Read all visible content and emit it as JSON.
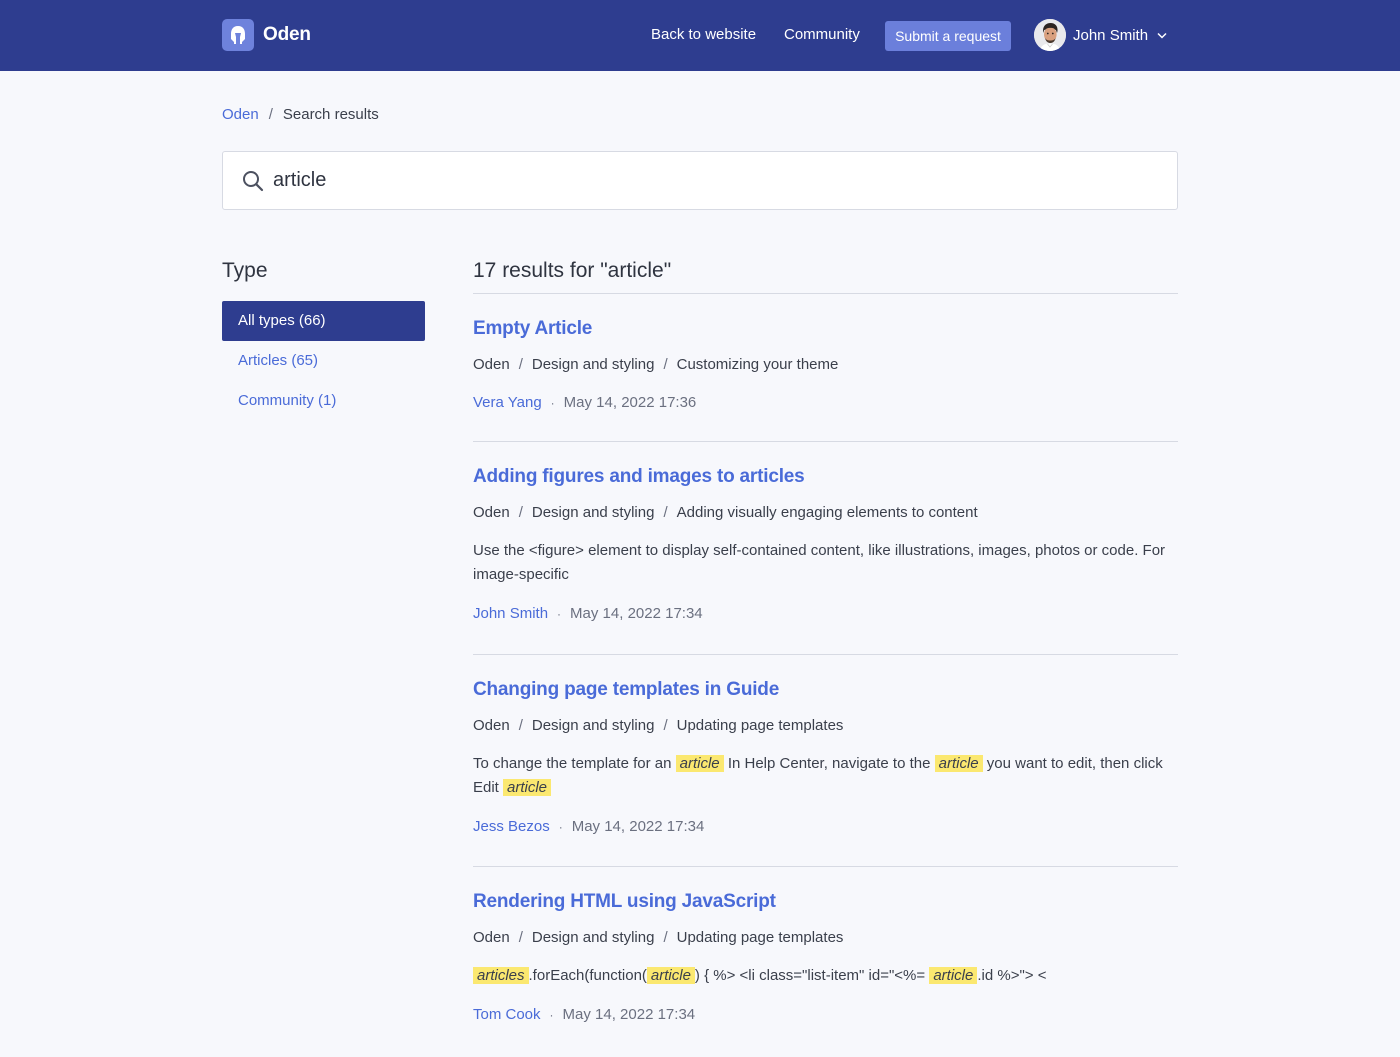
{
  "header": {
    "brand_name": "Oden",
    "nav": {
      "back_label": "Back to website",
      "community_label": "Community",
      "submit_label": "Submit a request"
    },
    "user": {
      "name": "John Smith"
    },
    "background_color": "#2e3d8f",
    "accent_color": "#6b7fdb"
  },
  "breadcrumb": {
    "home": "Oden",
    "separator": "/",
    "current": "Search results"
  },
  "search": {
    "value": "article",
    "icon": "search-icon"
  },
  "sidebar": {
    "title": "Type",
    "filters": [
      {
        "label": "All types (66)",
        "active": true
      },
      {
        "label": "Articles (65)",
        "active": false
      },
      {
        "label": "Community (1)",
        "active": false
      }
    ]
  },
  "results": {
    "count_text": "17 results for \"article\"",
    "separator": "/",
    "items": [
      {
        "title": "Empty Article",
        "path": [
          "Oden",
          "Design and styling",
          "Customizing your theme"
        ],
        "author": "Vera Yang",
        "date": "May 14, 2022 17:36"
      },
      {
        "title": "Adding figures and images to articles",
        "path": [
          "Oden",
          "Design and styling",
          "Adding visually engaging elements to content"
        ],
        "snippet": "Use the <figure> element to display self-contained content, like illustrations, images, photos or code. For image-specific",
        "author": "John Smith",
        "date": "May 14, 2022 17:34"
      },
      {
        "title": "Changing page templates in Guide",
        "path": [
          "Oden",
          "Design and styling",
          "Updating page templates"
        ],
        "snippet_parts": [
          "To change the template for an ",
          "article",
          " In Help Center, navigate to the ",
          "article",
          " you want to edit, then click Edit ",
          "article"
        ],
        "author": "Jess Bezos",
        "date": "May 14, 2022 17:34"
      },
      {
        "title": "Rendering HTML using JavaScript",
        "path": [
          "Oden",
          "Design and styling",
          "Updating page templates"
        ],
        "snippet_parts": [
          "articles",
          ".forEach(function(",
          "article",
          ") { %> <li class=\"list-item\" id=\"<%= ",
          "article",
          ".id %>\"> <"
        ],
        "author": "Tom Cook",
        "date": "May 14, 2022 17:34"
      }
    ]
  }
}
